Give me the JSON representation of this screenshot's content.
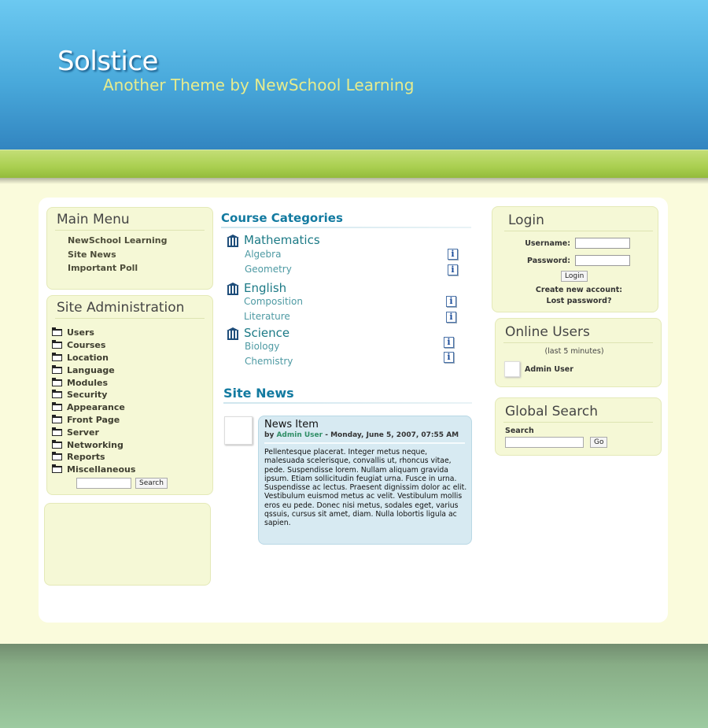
{
  "header": {
    "title": "Solstice",
    "subtitle": "Another Theme by NewSchool Learning"
  },
  "main_menu": {
    "title": "Main Menu",
    "items": [
      "NewSchool Learning",
      "Site News",
      "Important Poll"
    ]
  },
  "site_admin": {
    "title": "Site Administration",
    "items": [
      "Users",
      "Courses",
      "Location",
      "Language",
      "Modules",
      "Security",
      "Appearance",
      "Front Page",
      "Server",
      "Networking",
      "Reports",
      "Miscellaneous"
    ],
    "search_button": "Search"
  },
  "course_categories": {
    "title": "Course Categories",
    "categories": [
      {
        "name": "Mathematics",
        "courses": [
          "Algebra",
          "Geometry"
        ]
      },
      {
        "name": "English",
        "courses": [
          "Composition",
          "Literature"
        ]
      },
      {
        "name": "Science",
        "courses": [
          "Biology",
          "Chemistry"
        ]
      }
    ],
    "info_glyph": "i"
  },
  "site_news": {
    "title": "Site News",
    "item": {
      "title": "News Item",
      "by": "by",
      "author": "Admin User",
      "date": "- Monday, June 5, 2007, 07:55 AM",
      "body": "Pellentesque placerat. Integer metus neque, malesuada scelerisque, convallis ut, rhoncus vitae, pede. Suspendisse lorem. Nullam aliquam gravida ipsum. Etiam sollicitudin feugiat urna. Fusce in urna. Suspendisse ac lectus. Praesent dignissim dolor ac elit. Vestibulum euismod metus ac velit. Vestibulum mollis eros eu pede. Donec nisi metus, sodales eget, varius qssuis, cursus sit amet, diam. Nulla lobortis ligula ac sapien."
    }
  },
  "login": {
    "title": "Login",
    "username_label": "Username:",
    "password_label": "Password:",
    "login_button": "Login",
    "create_account": "Create new account:",
    "lost_password": "Lost password?"
  },
  "online_users": {
    "title": "Online Users",
    "note": "(last 5 minutes)",
    "user": "Admin User"
  },
  "global_search": {
    "title": "Global Search",
    "label": "Search",
    "go_button": "Go"
  },
  "colors": {
    "header_blue": "#49a9db",
    "green_bar": "#aacf50",
    "block_bg": "#f5f8d6",
    "heading_teal": "#127aa0",
    "news_bg": "#d7eaf2"
  }
}
